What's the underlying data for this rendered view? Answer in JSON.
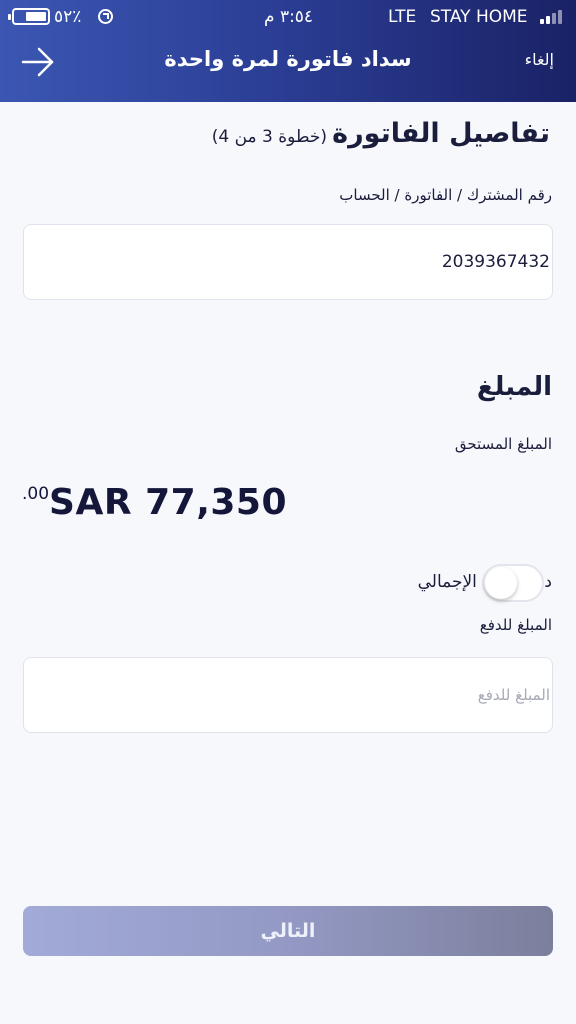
{
  "status_bar": {
    "battery_percent": "٥٢٪",
    "time": "٣:٥٤ م",
    "network": "LTE",
    "carrier": "STAY HOME"
  },
  "nav": {
    "title": "سداد فاتورة لمرة واحدة",
    "cancel_label": "إلغاء"
  },
  "step": {
    "title": "تفاصيل الفاتورة",
    "subtitle": "(خطوة 3 من 4)"
  },
  "account": {
    "label": "رقم المشترك / الفاتورة / الحساب",
    "value": "2039367432"
  },
  "amount_section": {
    "title": "المبلغ",
    "due_label": "المبلغ المستحق",
    "due_value": "SAR 77,350",
    "due_decimals": ".00",
    "pay_full_label": "دفع المبلغ الإجمالي",
    "pay_full_enabled": false,
    "pay_amount_label": "المبلغ للدفع",
    "pay_amount_placeholder": "المبلغ للدفع",
    "pay_amount_value": ""
  },
  "actions": {
    "next_label": "التالي"
  },
  "colors": {
    "header_start": "#3b57b2",
    "header_end": "#1a2266",
    "text_primary": "#1b1d3c",
    "button_disabled": "#9399c4",
    "background": "#f7f8fc"
  },
  "icons": {
    "back": "arrow-right-icon",
    "battery": "battery-icon",
    "orientation_lock": "orientation-lock-icon",
    "signal": "signal-bars-icon"
  }
}
